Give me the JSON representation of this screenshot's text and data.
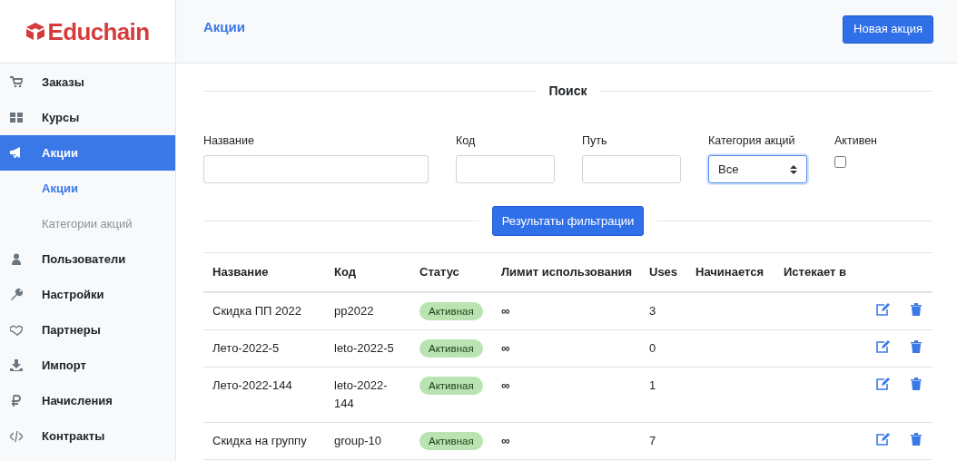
{
  "logo": "Educhain",
  "sidebar": {
    "items": [
      {
        "label": "Заказы",
        "selected": false
      },
      {
        "label": "Курсы",
        "selected": false
      },
      {
        "label": "Акции",
        "selected": true,
        "children": [
          {
            "label": "Акции",
            "selected": true
          },
          {
            "label": "Категории акций",
            "selected": false
          }
        ]
      },
      {
        "label": "Пользователи",
        "selected": false
      },
      {
        "label": "Настройки",
        "selected": false
      },
      {
        "label": "Партнеры",
        "selected": false
      },
      {
        "label": "Импорт",
        "selected": false
      },
      {
        "label": "Начисления",
        "selected": false
      },
      {
        "label": "Контракты",
        "selected": false
      }
    ]
  },
  "header": {
    "title": "Акции",
    "button": "Новая акция"
  },
  "search": {
    "title": "Поиск",
    "fields": [
      {
        "kind": "text",
        "label": "Название"
      },
      {
        "kind": "text",
        "label": "Код"
      },
      {
        "kind": "text",
        "label": "Путь"
      },
      {
        "kind": "select",
        "label": "Категория акций",
        "value": "Все"
      },
      {
        "kind": "checkbox",
        "label": "Активен",
        "checked": false
      }
    ],
    "button": "Результаты фильтрации"
  },
  "table": {
    "columns": [
      "Название",
      "Код",
      "Статус",
      "Лимит использования",
      "Uses",
      "Начинается",
      "Истекает в"
    ],
    "rows": [
      {
        "name": "Скидка ПП 2022",
        "code": "pp2022",
        "status": "Активная",
        "limit": "∞",
        "uses": "3"
      },
      {
        "name": "Лето-2022-5",
        "code": "leto-2022-5",
        "status": "Активная",
        "limit": "∞",
        "uses": "0"
      },
      {
        "name": "Лето-2022-144",
        "code": "leto-2022-144",
        "status": "Активная",
        "limit": "∞",
        "uses": "1"
      },
      {
        "name": "Скидка на группу",
        "code": "group-10",
        "status": "Активная",
        "limit": "∞",
        "uses": "7"
      }
    ]
  }
}
